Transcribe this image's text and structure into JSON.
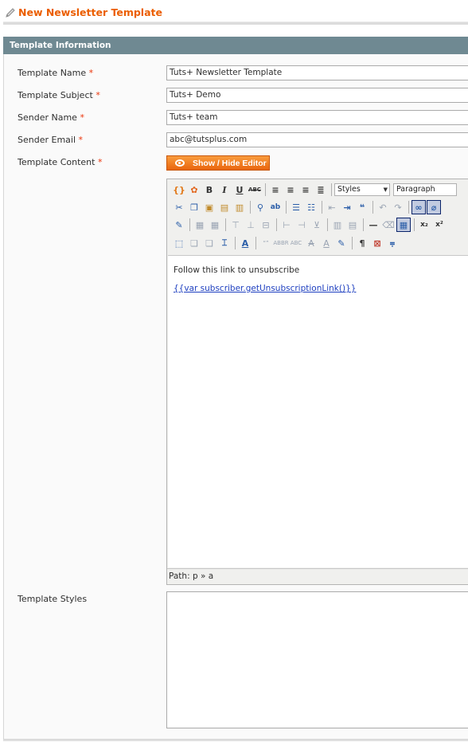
{
  "page": {
    "title": "New Newsletter Template",
    "header_icon": "pencil-icon"
  },
  "fieldset": {
    "legend": "Template Information"
  },
  "form": {
    "required_marker": "*",
    "template_name_label": "Template Name",
    "template_name_value": "Tuts+ Newsletter Template",
    "template_subject_label": "Template Subject",
    "template_subject_value": "Tuts+ Demo",
    "sender_name_label": "Sender Name",
    "sender_name_value": "Tuts+ team",
    "sender_email_label": "Sender Email",
    "sender_email_value": "abc@tutsplus.com",
    "template_content_label": "Template Content",
    "template_styles_label": "Template Styles",
    "template_styles_value": ""
  },
  "toggle_editor": {
    "label": "Show / Hide Editor",
    "icon": "eye-icon"
  },
  "editor": {
    "styles_select": "Styles",
    "format_select": "Paragraph",
    "content_line": "Follow this link to unsubscribe",
    "content_link": "{{var subscriber.getUnsubscriptionLink()}}",
    "path": "Path: p » a"
  },
  "colors": {
    "accent": "#eb5e00",
    "legend_bg": "#6f8992",
    "required": "#eb340a",
    "link": "#1f40c0",
    "button": "#f07c1c"
  }
}
